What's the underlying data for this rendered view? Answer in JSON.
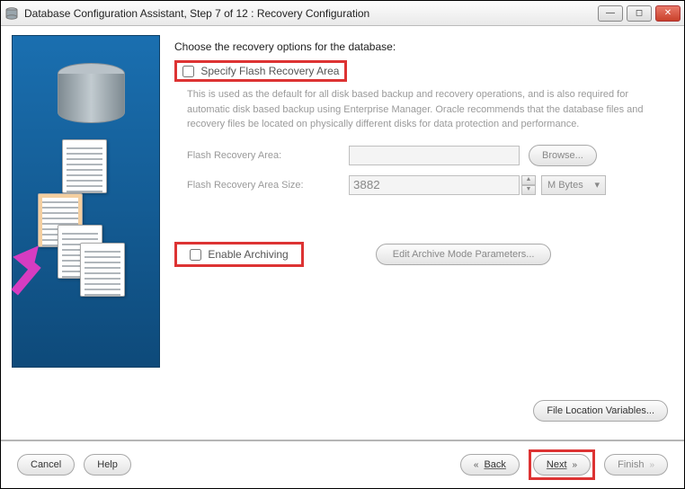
{
  "titlebar": {
    "title": "Database Configuration Assistant, Step 7 of 12 : Recovery Configuration"
  },
  "main": {
    "heading": "Choose the recovery options for the database:",
    "flash_checkbox_label": "Specify Flash Recovery Area",
    "flash_desc": "This is used as the default for all disk based backup and recovery operations, and is also required for automatic disk based backup using Enterprise Manager. Oracle recommends that the database files and recovery files be located on physically different disks for data protection and performance.",
    "area_label": "Flash Recovery Area:",
    "area_value": "",
    "browse_label": "Browse...",
    "size_label": "Flash Recovery Area Size:",
    "size_value": "3882",
    "unit_label": "M Bytes",
    "archive_checkbox_label": "Enable Archiving",
    "archive_params_label": "Edit Archive Mode Parameters...",
    "file_vars_label": "File Location Variables..."
  },
  "footer": {
    "cancel": "Cancel",
    "help": "Help",
    "back": "Back",
    "next": "Next",
    "finish": "Finish"
  }
}
